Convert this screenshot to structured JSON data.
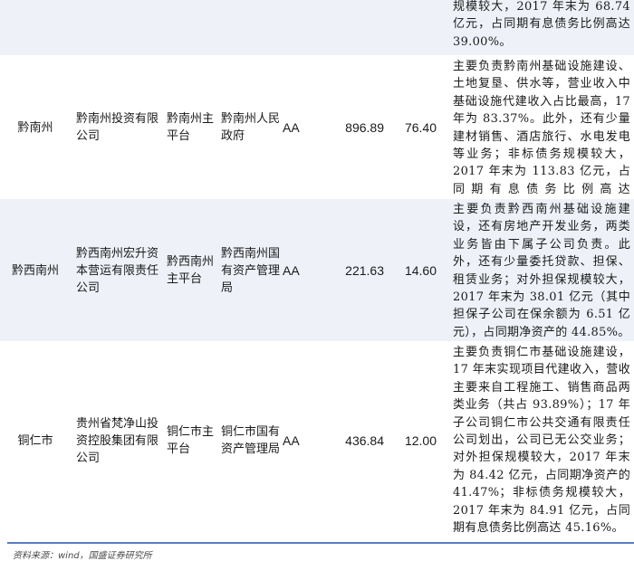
{
  "rows": [
    {
      "region": "",
      "company": "",
      "platform": "",
      "controller": "",
      "rating": "",
      "total_assets": "",
      "interest_debt": "",
      "description": "规模较大，2017 年末为 68.74 亿元，占同期有息债务比例高达39.00%。"
    },
    {
      "region": "黔南州",
      "company": "黔南州投资有限公司",
      "platform": "黔南州主平台",
      "controller": "黔南州人民政府",
      "rating": "AA",
      "total_assets": "896.89",
      "interest_debt": "76.40",
      "description": "主要负责黔南州基础设施建设、土地复垦、供水等，营业收入中基础设施代建收入占比最高，17 年为 83.37%。此外，还有少量建材销售、酒店旅行、水电发电等业务；非标债务规模较大，2017 年末为 113.83 亿元，占同期有息债务比例高达 33.83%。"
    },
    {
      "region": "黔西南州",
      "company": "黔西南州宏升资本营运有限责任公司",
      "platform": "黔西南州主平台",
      "controller": "黔西南州国有资产管理局",
      "rating": "AA",
      "total_assets": "221.63",
      "interest_debt": "14.60",
      "description": "主要负责黔西南州基础设施建设，还有房地产开发业务，两类业务皆由下属子公司负责。此外，还有少量委托贷款、担保、租赁业务；对外担保规模较大，2017 年末为 38.01 亿元（其中担保子公司在保余额为 6.51 亿元），占同期净资产的 44.85%。"
    },
    {
      "region": "铜仁市",
      "company": "贵州省梵净山投资控股集团有限公司",
      "platform": "铜仁市主平台",
      "controller": "铜仁市国有资产管理局",
      "rating": "AA",
      "total_assets": "436.84",
      "interest_debt": "12.00",
      "description": "主要负责铜仁市基础设施建设，17 年末实现项目代建收入，营收主要来自工程施工、销售商品两类业务（共占 93.89%）；17 年子公司铜仁市公共交通有限责任公司划出，公司已无公交业务；对外担保规模较大，2017 年末为 84.42 亿元，占同期净资产的 41.47%；非标债务规模较大，2017 年末为 84.91 亿元，占同期有息债务比例高达 45.16%。"
    }
  ],
  "source": "资料来源：wind，国盛证券研究所"
}
